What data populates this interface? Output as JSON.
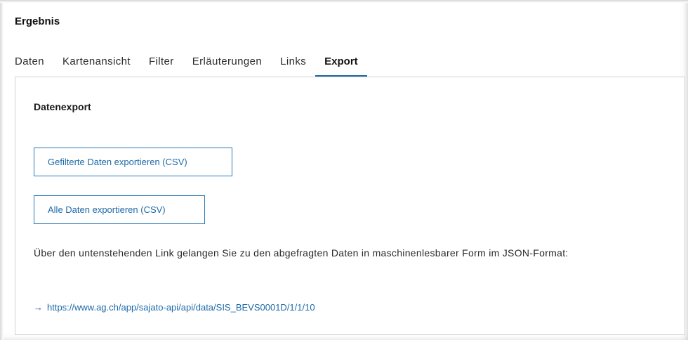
{
  "section": {
    "heading": "Ergebnis"
  },
  "tabs": [
    {
      "label": "Daten",
      "active": false
    },
    {
      "label": "Kartenansicht",
      "active": false
    },
    {
      "label": "Filter",
      "active": false
    },
    {
      "label": "Erläuterungen",
      "active": false
    },
    {
      "label": "Links",
      "active": false
    },
    {
      "label": "Export",
      "active": true
    }
  ],
  "export": {
    "title": "Datenexport",
    "filtered_button": "Gefilterte Daten exportieren (CSV)",
    "all_button": "Alle Daten exportieren (CSV)",
    "description": "Über den untenstehenden Link gelangen Sie zu den abgefragten Daten in maschinenlesbarer Form im JSON-Format:",
    "link_arrow": "→",
    "link_text": "https://www.ag.ch/app/sajato-api/api/data/SIS_BEVS0001D/1/1/10"
  },
  "colors": {
    "accent": "#1e6aa8",
    "border": "#d3d3d3"
  }
}
